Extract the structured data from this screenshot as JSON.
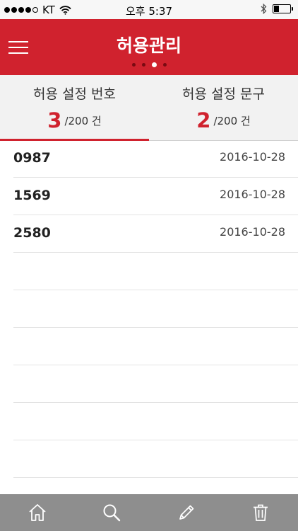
{
  "status_bar": {
    "carrier": "KT",
    "time": "오후 5:37",
    "battery_level": 0.3
  },
  "header": {
    "title": "허용관리",
    "page_count": 4,
    "active_page": 2
  },
  "tabs": [
    {
      "label": "허용 설정 번호",
      "count": "3",
      "unit": "/200 건",
      "active": true
    },
    {
      "label": "허용 설정 문구",
      "count": "2",
      "unit": "/200 건",
      "active": false
    }
  ],
  "list": {
    "rows": [
      {
        "number": "0987",
        "date": "2016-10-28"
      },
      {
        "number": "1569",
        "date": "2016-10-28"
      },
      {
        "number": "2580",
        "date": "2016-10-28"
      }
    ],
    "empty_rows": 6
  },
  "toolbar": {
    "icons": [
      "home-icon",
      "search-icon",
      "pencil-icon",
      "trash-icon"
    ]
  },
  "colors": {
    "accent": "#d0222e",
    "toolbar": "#8e8e8e",
    "tab_bg": "#f2f2f2"
  }
}
